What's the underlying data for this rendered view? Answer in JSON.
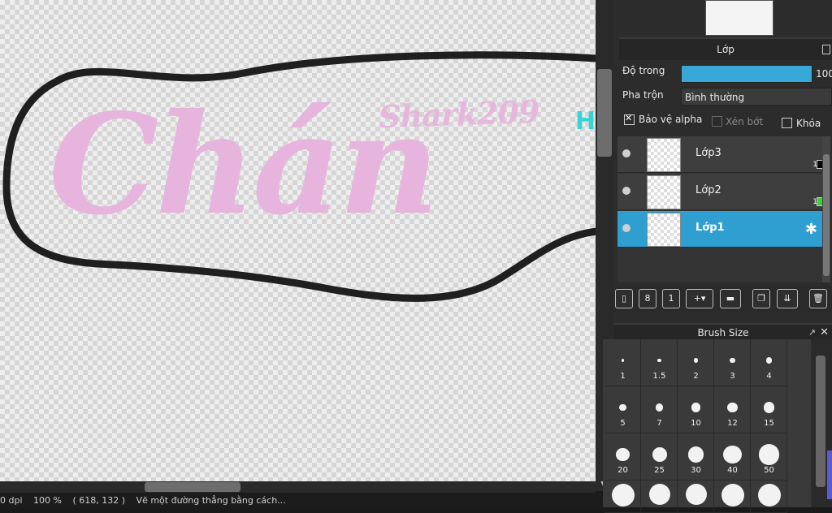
{
  "canvas": {
    "main_text": "Chán",
    "signature_text": "Shark209",
    "accent_text": "H"
  },
  "statusbar": {
    "dpi": "0 dpi",
    "zoom": "100 %",
    "coords": "( 618, 132 )",
    "hint": "Vẽ một đường thẳng bằng cách..."
  },
  "layer_panel": {
    "title": "Lớp",
    "opacity_label": "Độ trong",
    "opacity_value": "100",
    "blend_label": "Pha trộn",
    "blend_value": "Bình thường",
    "protect_alpha_label": "Bảo vệ alpha",
    "protect_alpha_checked": true,
    "clip_label": "Xén bớt",
    "clip_checked": false,
    "lock_label": "Khóa",
    "lock_checked": false,
    "layers": [
      {
        "name": "Lớp3",
        "number": "1",
        "selected": false
      },
      {
        "name": "Lớp2",
        "number": "1",
        "selected": false
      },
      {
        "name": "Lớp1",
        "number": "",
        "selected": true
      }
    ]
  },
  "toolbar": {
    "buttons": [
      "new-layer-icon",
      "new-8bit-layer-icon",
      "new-1bit-layer-icon",
      "add-layer-dropdown-icon",
      "folder-icon",
      "duplicate-icon",
      "merge-icon",
      "trash-icon"
    ]
  },
  "brush_panel": {
    "title": "Brush Size",
    "rows": [
      [
        "1",
        "1.5",
        "2",
        "3",
        "4"
      ],
      [
        "5",
        "7",
        "10",
        "12",
        "15"
      ],
      [
        "20",
        "25",
        "30",
        "40",
        "50"
      ]
    ]
  },
  "colors": {
    "accent": "#2f9ed0",
    "pink": "#e6b4dc",
    "panel_bg": "#2c2c2c"
  }
}
